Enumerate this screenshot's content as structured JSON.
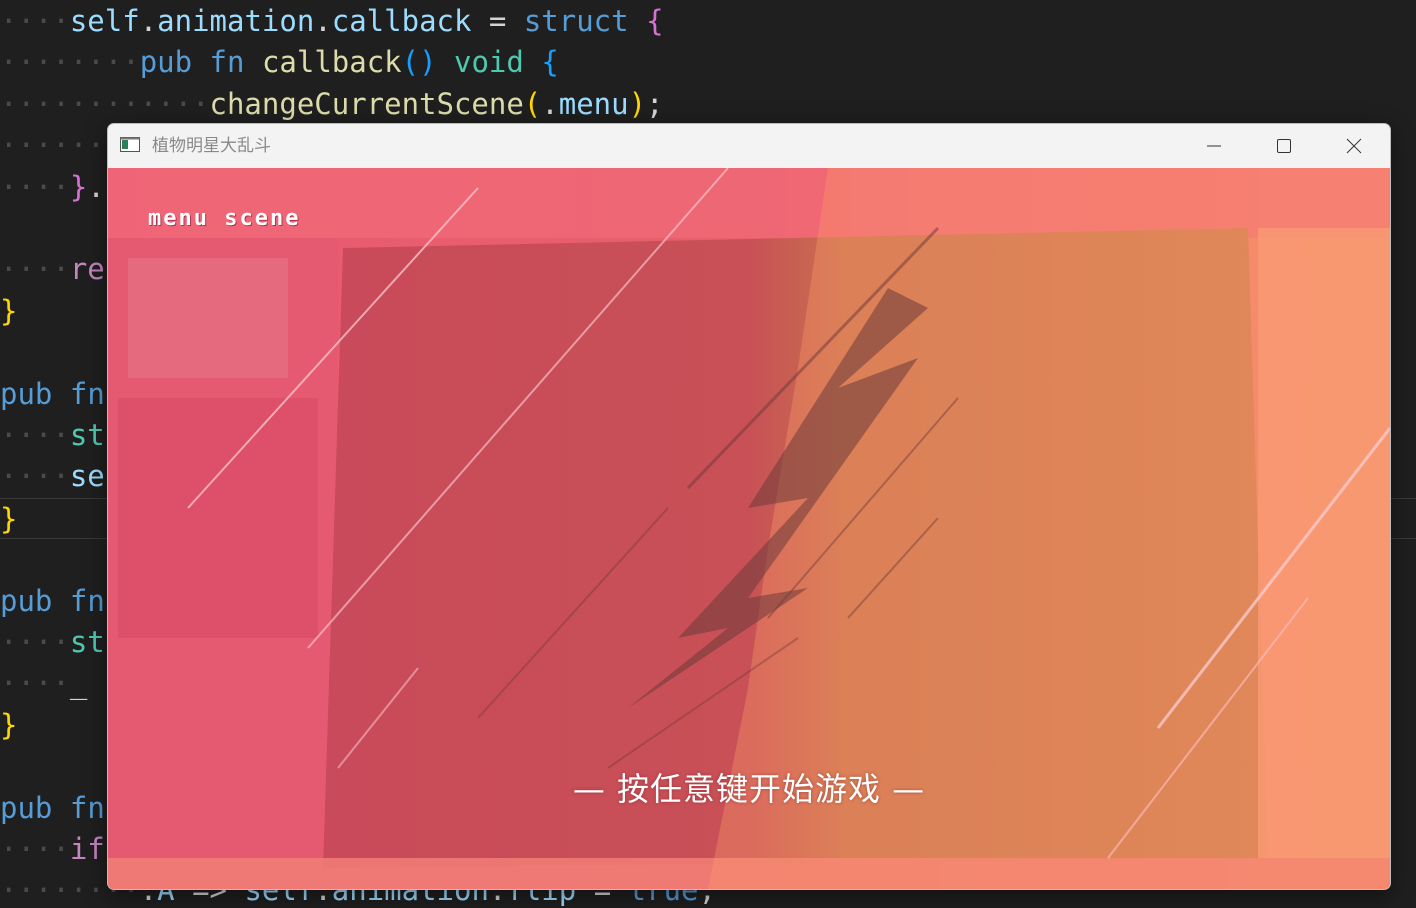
{
  "editor": {
    "lines": [
      {
        "dots": "····",
        "segments": [
          [
            "var-blue",
            "self"
          ],
          [
            "plain",
            "."
          ],
          [
            "var-blue",
            "animation"
          ],
          [
            "plain",
            "."
          ],
          [
            "var-blue",
            "callback"
          ],
          [
            "plain",
            " = "
          ],
          [
            "kw-blue",
            "struct"
          ],
          [
            "plain",
            " "
          ],
          [
            "brace-pink",
            "{"
          ]
        ]
      },
      {
        "dots": "········",
        "segments": [
          [
            "kw-blue",
            "pub"
          ],
          [
            "plain",
            " "
          ],
          [
            "kw-blue",
            "fn"
          ],
          [
            "plain",
            " "
          ],
          [
            "fn-yellow",
            "callback"
          ],
          [
            "brace-blue",
            "()"
          ],
          [
            "plain",
            " "
          ],
          [
            "ty-green",
            "void"
          ],
          [
            "plain",
            " "
          ],
          [
            "brace-blue",
            "{"
          ]
        ]
      },
      {
        "dots": "············",
        "segments": [
          [
            "fn-yellow",
            "changeCurrentScene"
          ],
          [
            "brace-gold",
            "("
          ],
          [
            "plain",
            "."
          ],
          [
            "var-blue",
            "menu"
          ],
          [
            "brace-gold",
            ")"
          ],
          [
            "plain",
            ";"
          ]
        ]
      },
      {
        "dots": "········",
        "segments": []
      },
      {
        "dots": "····",
        "segments": [
          [
            "brace-pink",
            "}"
          ],
          [
            "plain",
            "."
          ]
        ]
      },
      {
        "dots": "",
        "segments": []
      },
      {
        "dots": "····",
        "segments": [
          [
            "kw-purple",
            "re"
          ]
        ]
      },
      {
        "dots": "",
        "segments": [
          [
            "brace-gold",
            "}"
          ]
        ]
      },
      {
        "dots": "",
        "segments": []
      },
      {
        "dots": "",
        "segments": [
          [
            "kw-blue",
            "pub"
          ],
          [
            "plain",
            " "
          ],
          [
            "kw-blue",
            "fn"
          ]
        ]
      },
      {
        "dots": "····",
        "segments": [
          [
            "ty-green",
            "st"
          ]
        ]
      },
      {
        "dots": "····",
        "segments": [
          [
            "var-blue",
            "se"
          ]
        ]
      },
      {
        "dots": "",
        "segments": [
          [
            "brace-gold",
            "}"
          ]
        ],
        "current": true
      },
      {
        "dots": "",
        "segments": []
      },
      {
        "dots": "",
        "segments": [
          [
            "kw-blue",
            "pub"
          ],
          [
            "plain",
            " "
          ],
          [
            "kw-blue",
            "fn"
          ]
        ]
      },
      {
        "dots": "····",
        "segments": [
          [
            "ty-green",
            "st"
          ]
        ]
      },
      {
        "dots": "····",
        "segments": [
          [
            "plain",
            "_"
          ]
        ]
      },
      {
        "dots": "",
        "segments": [
          [
            "brace-gold",
            "}"
          ]
        ]
      },
      {
        "dots": "",
        "segments": []
      },
      {
        "dots": "",
        "segments": [
          [
            "kw-blue",
            "pub"
          ],
          [
            "plain",
            " "
          ],
          [
            "kw-blue",
            "fn"
          ]
        ]
      },
      {
        "dots": "····",
        "segments": [
          [
            "kw-purple",
            "if"
          ]
        ]
      },
      {
        "dots": "········",
        "segments": [
          [
            "plain",
            "."
          ],
          [
            "var-blue",
            "A"
          ],
          [
            "plain",
            " => "
          ],
          [
            "var-blue",
            "self"
          ],
          [
            "plain",
            "."
          ],
          [
            "var-blue",
            "animation"
          ],
          [
            "plain",
            "."
          ],
          [
            "var-blue",
            "flip"
          ],
          [
            "plain",
            " = "
          ],
          [
            "kw-blue",
            "true"
          ],
          [
            "plain",
            ","
          ]
        ]
      }
    ]
  },
  "window": {
    "title": "植物明星大乱斗",
    "icon": "app-window-icon",
    "controls": {
      "minimize": "minimize-icon",
      "maximize": "maximize-icon",
      "close": "close-icon"
    }
  },
  "game": {
    "scene_label": "menu scene",
    "start_prompt": "— 按任意键开始游戏 —"
  },
  "colors": {
    "editor_bg": "#1f1f1f",
    "overlay_pink": "#e8506e",
    "overlay_orange": "#ff8a60",
    "lawn_dark": "#8a3a3a"
  }
}
